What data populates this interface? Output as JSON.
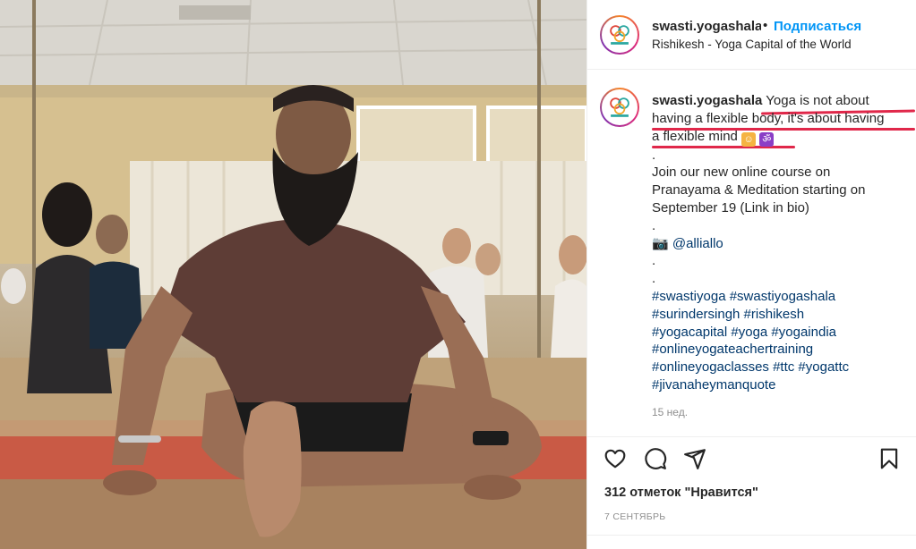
{
  "post": {
    "username": "swasti.yogashala",
    "follow_label": "Подписаться",
    "separator": "•",
    "location": "Rishikesh - Yoga Capital of the World",
    "more_icon": "more-options-icon"
  },
  "caption": {
    "username": "swasti.yogashala",
    "line1_text": " Yoga is not about",
    "line2_text": "having a flexible body, it's about having",
    "line3_text": "a flexible mind ",
    "dot1": ".",
    "line4": "Join our new online course on",
    "line5": "Pranayama & Meditation starting on",
    "line6": "September 19 (Link in bio)",
    "dot2": ".",
    "camera_emoji": "📷",
    "mention": "@alliallo",
    "dot3": ".",
    "dot4": ".",
    "tags": [
      "#swastiyoga #swastiyogashala",
      "#surindersingh #rishikesh",
      "#yogacapital #yoga #yogaindia",
      "#onlineyogateachertraining",
      "#onlineyogaclasses #ttc #yogattc",
      "#jivanaheymanquote"
    ],
    "time_ago": "15 нед.",
    "emoji_person": "person-in-lotus-position-emoji",
    "emoji_om": "om-symbol-emoji"
  },
  "actions": {
    "like_icon": "heart-icon",
    "comment_icon": "comment-icon",
    "share_icon": "share-icon",
    "save_icon": "bookmark-icon"
  },
  "likes_text": "312 отметок \"Нравится\"",
  "date_text": "7 СЕНТЯБРЬ",
  "colors": {
    "follow_blue": "#0095f6",
    "link_navy": "#00376b",
    "highlight_red": "#e0284a",
    "muted_gray": "#8e8e8e"
  }
}
